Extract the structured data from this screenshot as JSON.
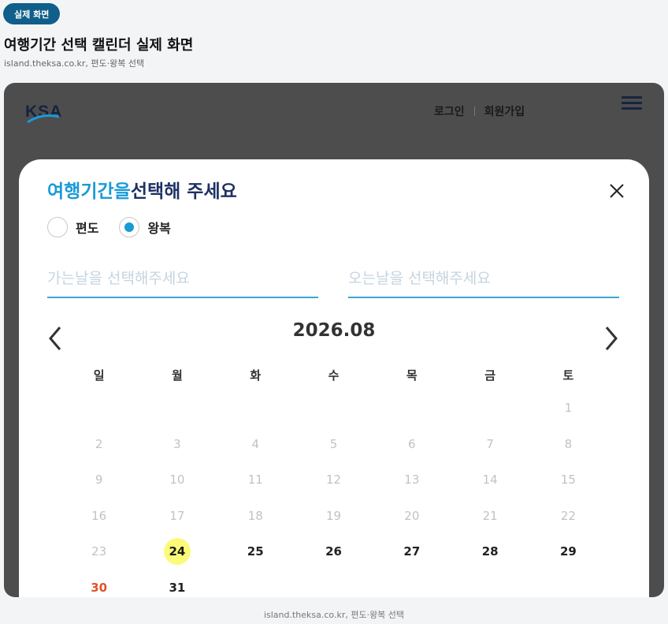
{
  "badge": "실제 화면",
  "heading": "여행기간 선택 캘린더 실제 화면",
  "subheading": "island.theksa.co.kr, 편도·왕복 선택",
  "caption": "island.theksa.co.kr, 편도·왕복 선택",
  "header": {
    "logo_text": "KSA",
    "login": "로그인",
    "signup": "회원가입"
  },
  "modal": {
    "title_accent": "여행기간을",
    "title_main": "선택해 주세요",
    "radio": [
      {
        "label": "편도",
        "checked": false
      },
      {
        "label": "왕복",
        "checked": true
      }
    ],
    "go_placeholder": "가는날을 선택해주세요",
    "back_placeholder": "오는날을 선택해주세요",
    "month": "2026.08",
    "weekdays": [
      "일",
      "월",
      "화",
      "수",
      "목",
      "금",
      "토"
    ],
    "weeks": [
      [
        null,
        null,
        null,
        null,
        null,
        null,
        {
          "d": "1",
          "s": "past"
        }
      ],
      [
        {
          "d": "2",
          "s": "past"
        },
        {
          "d": "3",
          "s": "past"
        },
        {
          "d": "4",
          "s": "past"
        },
        {
          "d": "5",
          "s": "past"
        },
        {
          "d": "6",
          "s": "past"
        },
        {
          "d": "7",
          "s": "past"
        },
        {
          "d": "8",
          "s": "past"
        }
      ],
      [
        {
          "d": "9",
          "s": "past"
        },
        {
          "d": "10",
          "s": "past"
        },
        {
          "d": "11",
          "s": "past"
        },
        {
          "d": "12",
          "s": "past"
        },
        {
          "d": "13",
          "s": "past"
        },
        {
          "d": "14",
          "s": "past"
        },
        {
          "d": "15",
          "s": "past"
        }
      ],
      [
        {
          "d": "16",
          "s": "past"
        },
        {
          "d": "17",
          "s": "past"
        },
        {
          "d": "18",
          "s": "past"
        },
        {
          "d": "19",
          "s": "past"
        },
        {
          "d": "20",
          "s": "past"
        },
        {
          "d": "21",
          "s": "past"
        },
        {
          "d": "22",
          "s": "past"
        }
      ],
      [
        {
          "d": "23",
          "s": "past"
        },
        {
          "d": "24",
          "s": "today"
        },
        {
          "d": "25",
          "s": "avail"
        },
        {
          "d": "26",
          "s": "avail"
        },
        {
          "d": "27",
          "s": "avail"
        },
        {
          "d": "28",
          "s": "avail"
        },
        {
          "d": "29",
          "s": "avail"
        }
      ],
      [
        {
          "d": "30",
          "s": "sunday"
        },
        {
          "d": "31",
          "s": "avail"
        },
        null,
        null,
        null,
        null,
        null
      ]
    ]
  },
  "colors": {
    "accent": "#1a9ad6",
    "title_dark": "#1d3163",
    "sunday": "#e0522a",
    "today_highlight": "#fcfa79",
    "badge": "#0f5f8a"
  }
}
